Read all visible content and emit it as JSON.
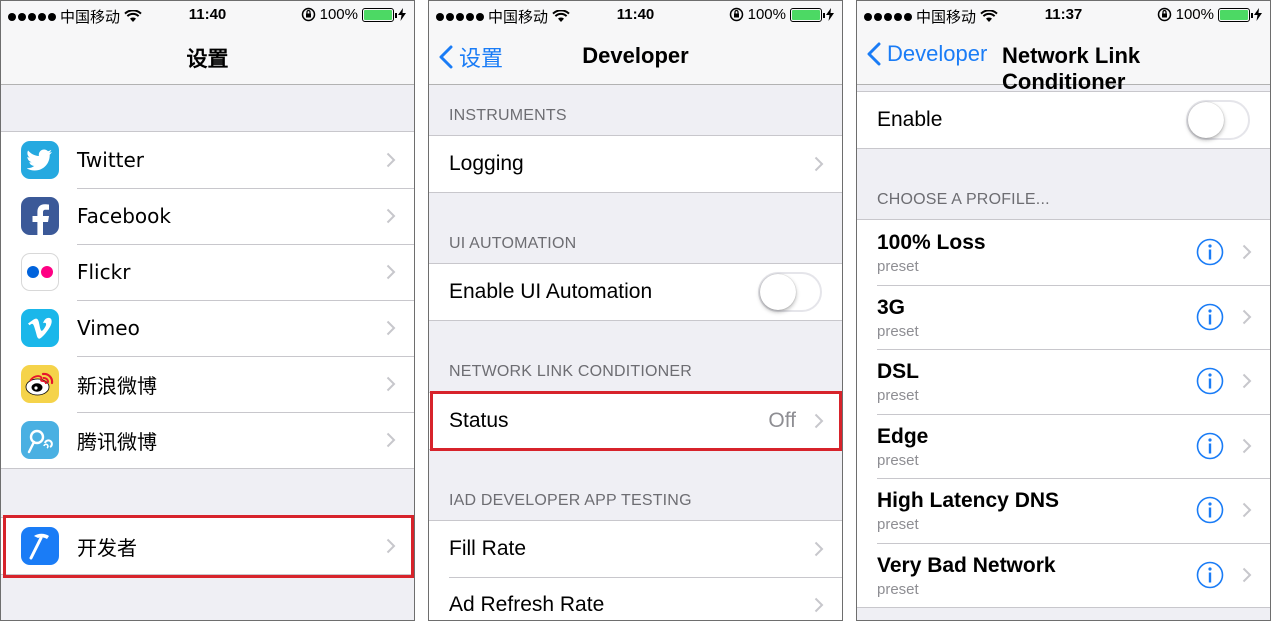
{
  "colors": {
    "accent": "#1a7cf6",
    "highlight": "#d7232b",
    "battery": "#4cd964"
  },
  "status_bars": [
    {
      "carrier": "中国移动",
      "time": "11:40",
      "battery": "100%"
    },
    {
      "carrier": "中国移动",
      "time": "11:40",
      "battery": "100%"
    },
    {
      "carrier": "中国移动",
      "time": "11:37",
      "battery": "100%"
    }
  ],
  "screen1": {
    "title": "设置",
    "social": [
      {
        "label": "Twitter",
        "icon": "twitter-icon"
      },
      {
        "label": "Facebook",
        "icon": "facebook-icon"
      },
      {
        "label": "Flickr",
        "icon": "flickr-icon"
      },
      {
        "label": "Vimeo",
        "icon": "vimeo-icon"
      },
      {
        "label": "新浪微博",
        "icon": "sina-weibo-icon"
      },
      {
        "label": "腾讯微博",
        "icon": "tencent-weibo-icon"
      }
    ],
    "developer": {
      "label": "开发者",
      "icon": "developer-hammer-icon"
    }
  },
  "screen2": {
    "back": "设置",
    "title": "Developer",
    "instruments_header": "INSTRUMENTS",
    "logging": "Logging",
    "ui_automation_header": "UI AUTOMATION",
    "enable_ui_automation": "Enable UI Automation",
    "enable_ui_automation_on": false,
    "nlc_header": "NETWORK LINK CONDITIONER",
    "status": "Status",
    "status_value": "Off",
    "iad_header": "IAD DEVELOPER APP TESTING",
    "fill_rate": "Fill Rate",
    "ad_refresh_rate": "Ad Refresh Rate"
  },
  "screen3": {
    "back": "Developer",
    "title": "Network Link Conditioner",
    "enable": "Enable",
    "enable_on": false,
    "profile_header": "CHOOSE A PROFILE...",
    "profiles": [
      {
        "name": "100% Loss",
        "sub": "preset"
      },
      {
        "name": "3G",
        "sub": "preset"
      },
      {
        "name": "DSL",
        "sub": "preset"
      },
      {
        "name": "Edge",
        "sub": "preset"
      },
      {
        "name": "High Latency DNS",
        "sub": "preset"
      },
      {
        "name": "Very Bad Network",
        "sub": "preset"
      }
    ]
  }
}
